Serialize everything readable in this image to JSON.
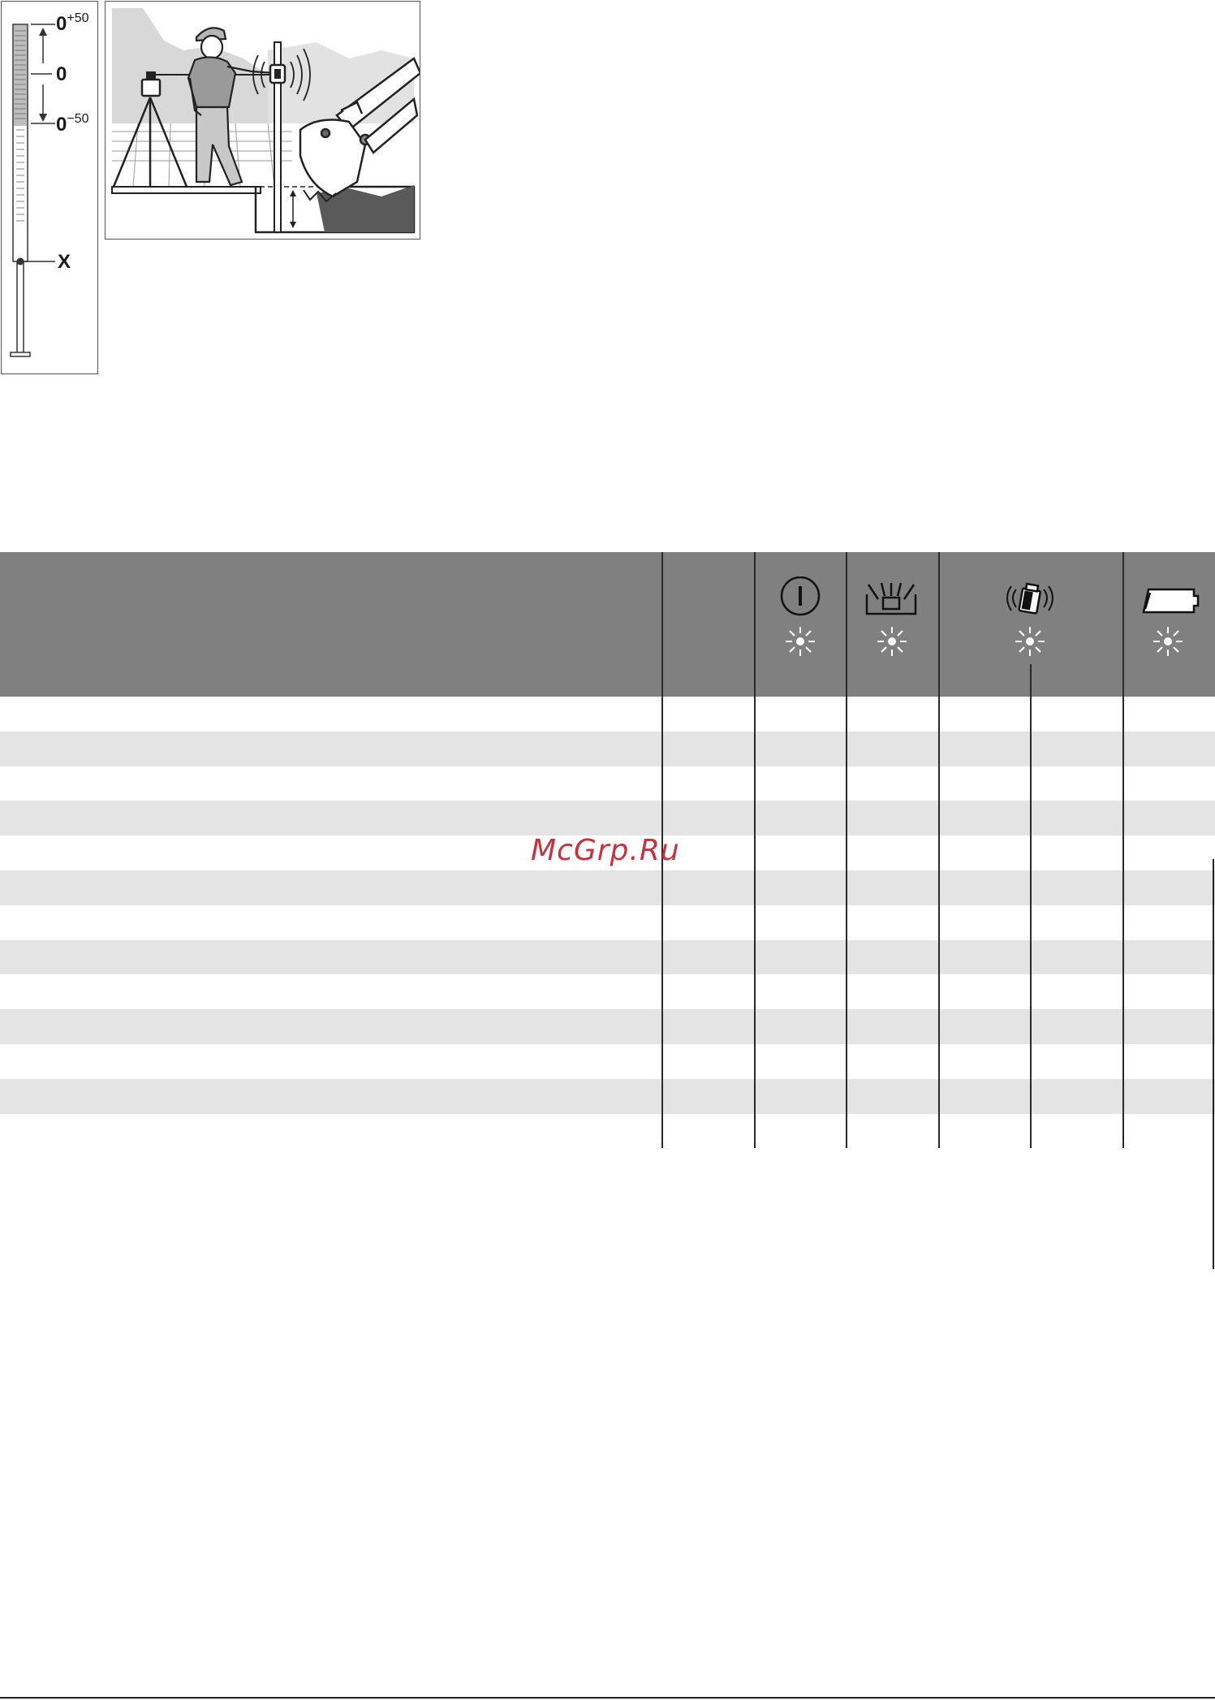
{
  "figures": {
    "staff": {
      "label_plus": "0",
      "label_plus_sup": "+50",
      "label_zero": "0",
      "label_minus": "0",
      "label_minus_sup": "−50",
      "label_x": "X"
    }
  },
  "table": {
    "header_icons": [
      "power-icon",
      "rotating-beam-icon",
      "tilt-alert-icon",
      "battery-icon"
    ],
    "row_count": 13
  },
  "watermark": "McGrp.Ru",
  "colors": {
    "header_bg": "#808080",
    "row_shade": "#e4e4e4",
    "watermark": "#c8323c"
  }
}
